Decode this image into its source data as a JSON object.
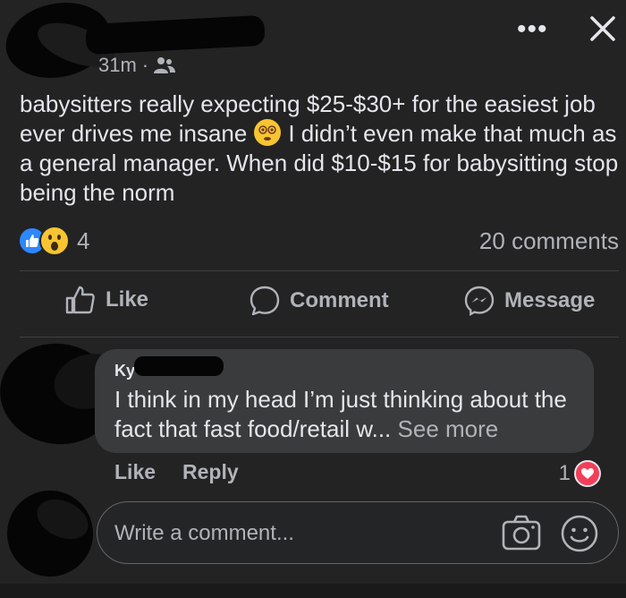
{
  "post": {
    "time": "31m",
    "separator": "·",
    "text_before_emoji": "babysitters really expecting $25-$30+ for the easiest job ever drives me insane",
    "text_after_emoji": "I didn’t even make that much as a general manager. When did $10-$15 for babysitting stop being the norm",
    "reaction_count": "4",
    "comments_count": "20 comments"
  },
  "actions": {
    "like": "Like",
    "comment": "Comment",
    "message": "Message"
  },
  "comment": {
    "author": "Ky",
    "text": "I think in my head I’m just thinking about the fact that fast food/retail w...",
    "see_more": "See more",
    "like": "Like",
    "reply": "Reply",
    "reaction_count": "1"
  },
  "composer": {
    "placeholder": "Write a comment..."
  },
  "colors": {
    "background": "#232324",
    "like_blue": "#2d88ff",
    "heart_red": "#f33e58",
    "wow_yellow": "#f7c531"
  }
}
